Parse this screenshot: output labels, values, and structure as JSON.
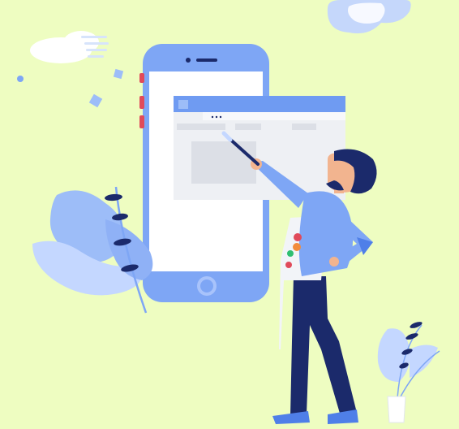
{
  "illustration": {
    "subject": "developer-painting-web-page-on-phone",
    "icons": {
      "phone": "smartphone-icon",
      "browser": "browser-window-icon",
      "painter": "painter-figure-icon",
      "brush": "paintbrush-icon",
      "palette": "paint-palette-icon",
      "plant_left": "leaf-plant-icon",
      "plant_right": "potted-plant-icon",
      "cloud": "cloud-icon"
    },
    "colors": {
      "background": "#eefdc1",
      "phone_body": "#7ea6f5",
      "phone_screen": "#ffffff",
      "browser_bar": "#6f9bf2",
      "shirt": "#7ea6f5",
      "pants": "#1b2a6b",
      "hair": "#1b2a6b",
      "skin": "#f2b48f",
      "leaf_light": "#c4d7ff",
      "leaf_mid": "#8fb1f6"
    }
  }
}
